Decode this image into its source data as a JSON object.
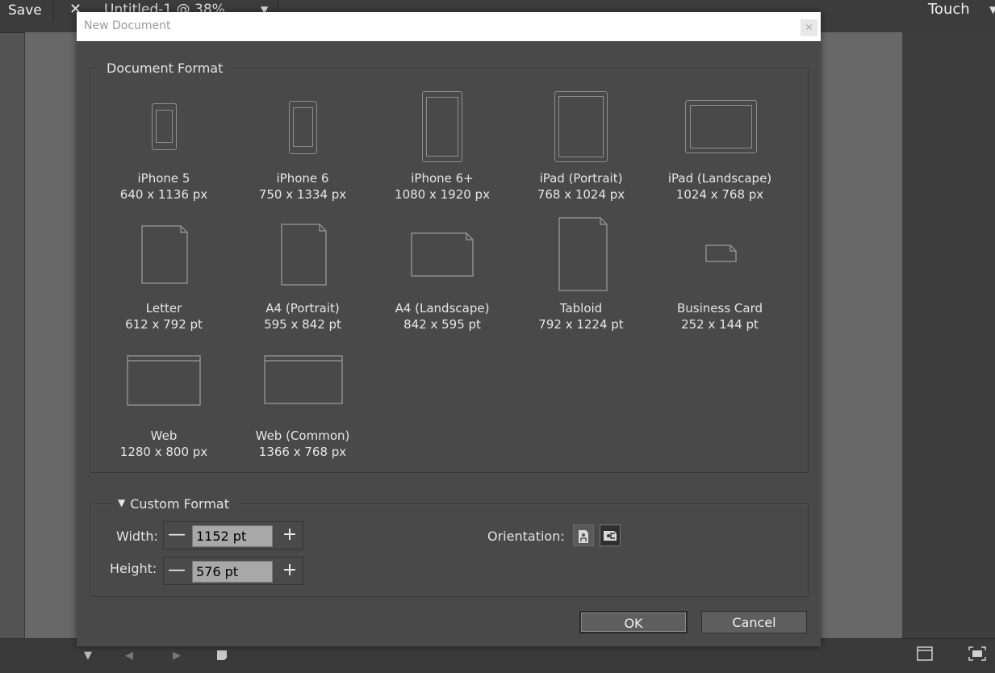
{
  "app": {
    "save_label": "Save",
    "tab_title": "Untitled-1 @ 38%",
    "workspace_label": "Touch"
  },
  "dialog": {
    "title": "New Document",
    "document_format": {
      "legend": "Document Format",
      "presets": [
        {
          "name": "iPhone 5",
          "size": "640 x 1136 px",
          "icon": "device-portrait-icon"
        },
        {
          "name": "iPhone 6",
          "size": "750 x 1334 px",
          "icon": "device-portrait-icon"
        },
        {
          "name": "iPhone 6+",
          "size": "1080 x 1920 px",
          "icon": "device-portrait-icon"
        },
        {
          "name": "iPad (Portrait)",
          "size": "768 x 1024 px",
          "icon": "tablet-portrait-icon"
        },
        {
          "name": "iPad (Landscape)",
          "size": "1024 x 768 px",
          "icon": "tablet-landscape-icon"
        },
        {
          "name": "Letter",
          "size": "612 x 792 pt",
          "icon": "page-icon"
        },
        {
          "name": "A4 (Portrait)",
          "size": "595 x 842 pt",
          "icon": "page-icon"
        },
        {
          "name": "A4 (Landscape)",
          "size": "842 x 595 pt",
          "icon": "page-landscape-icon"
        },
        {
          "name": "Tabloid",
          "size": "792 x 1224 pt",
          "icon": "page-icon"
        },
        {
          "name": "Business Card",
          "size": "252 x 144 pt",
          "icon": "card-icon"
        },
        {
          "name": "Web",
          "size": "1280 x 800 px",
          "icon": "browser-window-icon"
        },
        {
          "name": "Web (Common)",
          "size": "1366 x 768 px",
          "icon": "browser-window-icon"
        }
      ]
    },
    "custom_format": {
      "legend": "Custom Format",
      "width_label": "Width:",
      "width_value": "1152 pt",
      "height_label": "Height:",
      "height_value": "576 pt",
      "orientation_label": "Orientation:",
      "orientation_selected": "landscape"
    },
    "ok_label": "OK",
    "cancel_label": "Cancel"
  }
}
